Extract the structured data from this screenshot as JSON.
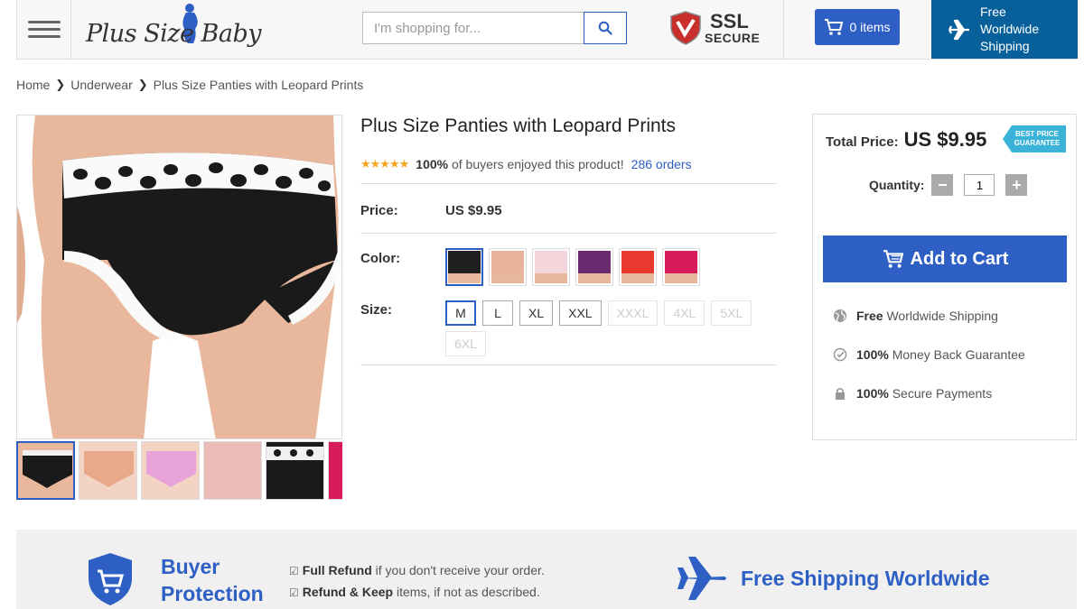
{
  "header": {
    "logo_text": "Plus Size Baby",
    "search_placeholder": "I'm shopping for...",
    "ssl_title": "SSL",
    "ssl_subtitle": "SECURE",
    "cart_label": "0 items",
    "shipping_label": "Free Worldwide Shipping"
  },
  "breadcrumb": [
    "Home",
    "Underwear",
    "Plus Size Panties with Leopard Prints"
  ],
  "product": {
    "title": "Plus Size Panties with Leopard Prints",
    "stars": "★★★★★",
    "rating_pct": "100%",
    "rating_text": "of buyers enjoyed this product!",
    "orders": "286 orders",
    "price_label": "Price:",
    "price": "US $9.95",
    "color_label": "Color:",
    "size_label": "Size:",
    "colors": [
      {
        "name": "black",
        "hex": "#1f1f1f",
        "active": true
      },
      {
        "name": "nude",
        "hex": "#e8b39b",
        "active": false
      },
      {
        "name": "light-pink",
        "hex": "#f5d5dc",
        "active": false
      },
      {
        "name": "purple",
        "hex": "#6b2a6e",
        "active": false
      },
      {
        "name": "red",
        "hex": "#e8392f",
        "active": false
      },
      {
        "name": "rose",
        "hex": "#d81c5b",
        "active": false
      }
    ],
    "sizes": [
      {
        "label": "M",
        "state": "active"
      },
      {
        "label": "L",
        "state": "normal"
      },
      {
        "label": "XL",
        "state": "normal"
      },
      {
        "label": "XXL",
        "state": "normal"
      },
      {
        "label": "XXXL",
        "state": "disabled"
      },
      {
        "label": "4XL",
        "state": "disabled"
      },
      {
        "label": "5XL",
        "state": "disabled"
      },
      {
        "label": "6XL",
        "state": "disabled"
      }
    ]
  },
  "buybox": {
    "total_label": "Total Price:",
    "total": "US $9.95",
    "badge_line1": "BEST PRICE",
    "badge_line2": "GUARANTEE",
    "quantity_label": "Quantity:",
    "quantity": "1",
    "minus": "−",
    "plus": "+",
    "add_to_cart": "Add to Cart",
    "features": [
      {
        "bold": "Free",
        "text": "Worldwide Shipping",
        "icon": "globe-icon"
      },
      {
        "bold": "100%",
        "text": "Money Back Guarantee",
        "icon": "check-circle-icon"
      },
      {
        "bold": "100%",
        "text": "Secure Payments",
        "icon": "lock-icon"
      }
    ]
  },
  "banner": {
    "buyer_protection_line1": "Buyer",
    "buyer_protection_line2": "Protection",
    "point1_bold": "Full Refund",
    "point1_text": "if you don't receive your order.",
    "point2_bold": "Refund & Keep",
    "point2_text": "items, if not as described.",
    "free_shipping": "Free Shipping Worldwide"
  },
  "colors": {
    "accent": "#2d5fc4",
    "shipping_bg": "#08609b",
    "star": "#f5a623",
    "badge": "#3bb3d9"
  }
}
